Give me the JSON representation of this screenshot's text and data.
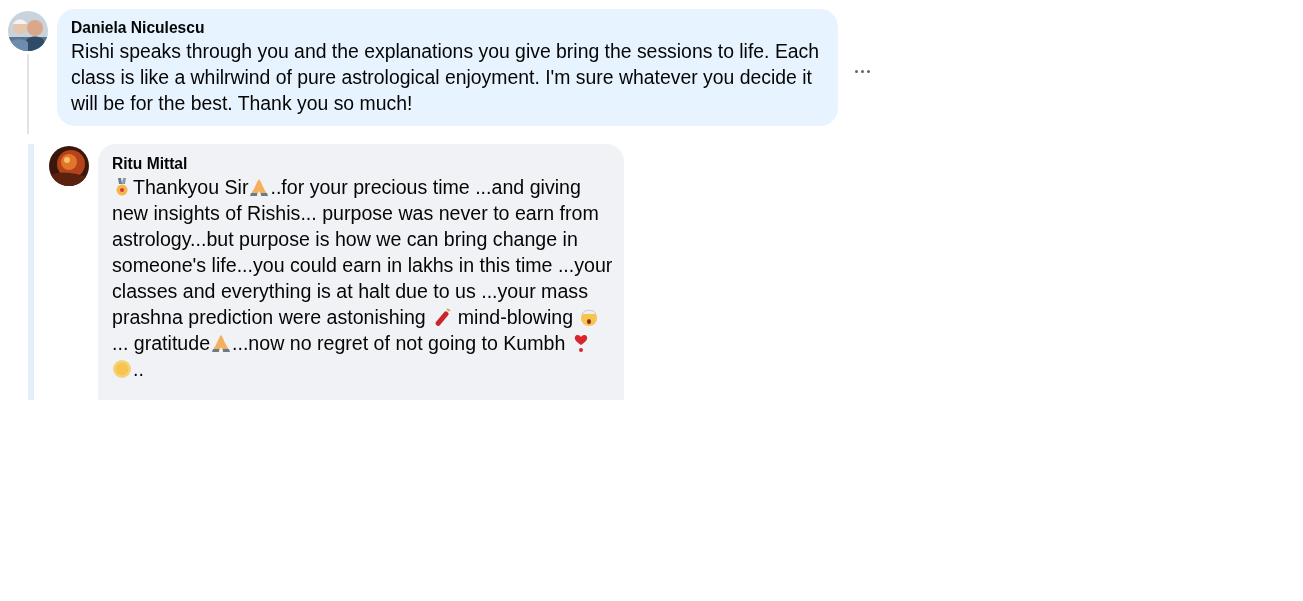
{
  "comments": [
    {
      "author": "Daniela Niculescu",
      "color": "#e7f3ff",
      "has_menu": true,
      "thread_line": true,
      "reply_bar": false,
      "lines": [
        [
          {
            "kind": "text",
            "text": "Rishi speaks through you and the explanations you give bring the sessions to life. Each"
          }
        ],
        [
          {
            "kind": "text",
            "text": "class is like a whilrwind of pure astrological enjoyment. I'm sure whatever you decide it"
          }
        ],
        [
          {
            "kind": "text",
            "text": "will be for the best. Thank you so much!"
          }
        ]
      ]
    },
    {
      "author": "Ritu Mittal",
      "color": "#f0f2f5",
      "has_menu": false,
      "thread_line": false,
      "reply_bar": true,
      "lines": [
        [
          {
            "kind": "medal"
          },
          {
            "kind": "text",
            "text": "Thankyou Sir"
          },
          {
            "kind": "hands"
          },
          {
            "kind": "text",
            "text": "..for your precious time ...and giving"
          }
        ],
        [
          {
            "kind": "text",
            "text": "new insights of Rishis... purpose was never to earn from"
          }
        ],
        [
          {
            "kind": "text",
            "text": "astrology...but purpose is how we can bring change in"
          }
        ],
        [
          {
            "kind": "text",
            "text": "someone's life...you could earn in lakhs in this time ...your"
          }
        ],
        [
          {
            "kind": "text",
            "text": "classes and everything is at halt due to us ...your mass"
          }
        ],
        [
          {
            "kind": "text",
            "text": "prashna prediction were astonishing"
          },
          {
            "kind": "firecracker"
          },
          {
            "kind": "text",
            "text": "mind-blowing"
          },
          {
            "kind": "shocked"
          }
        ],
        [
          {
            "kind": "text",
            "text": "... gratitude"
          },
          {
            "kind": "hands"
          },
          {
            "kind": "text",
            "text": "...now no regret of not going to Kumbh"
          },
          {
            "kind": "heart"
          }
        ],
        [
          {
            "kind": "sun"
          },
          {
            "kind": "text",
            "text": ".."
          }
        ]
      ]
    }
  ]
}
